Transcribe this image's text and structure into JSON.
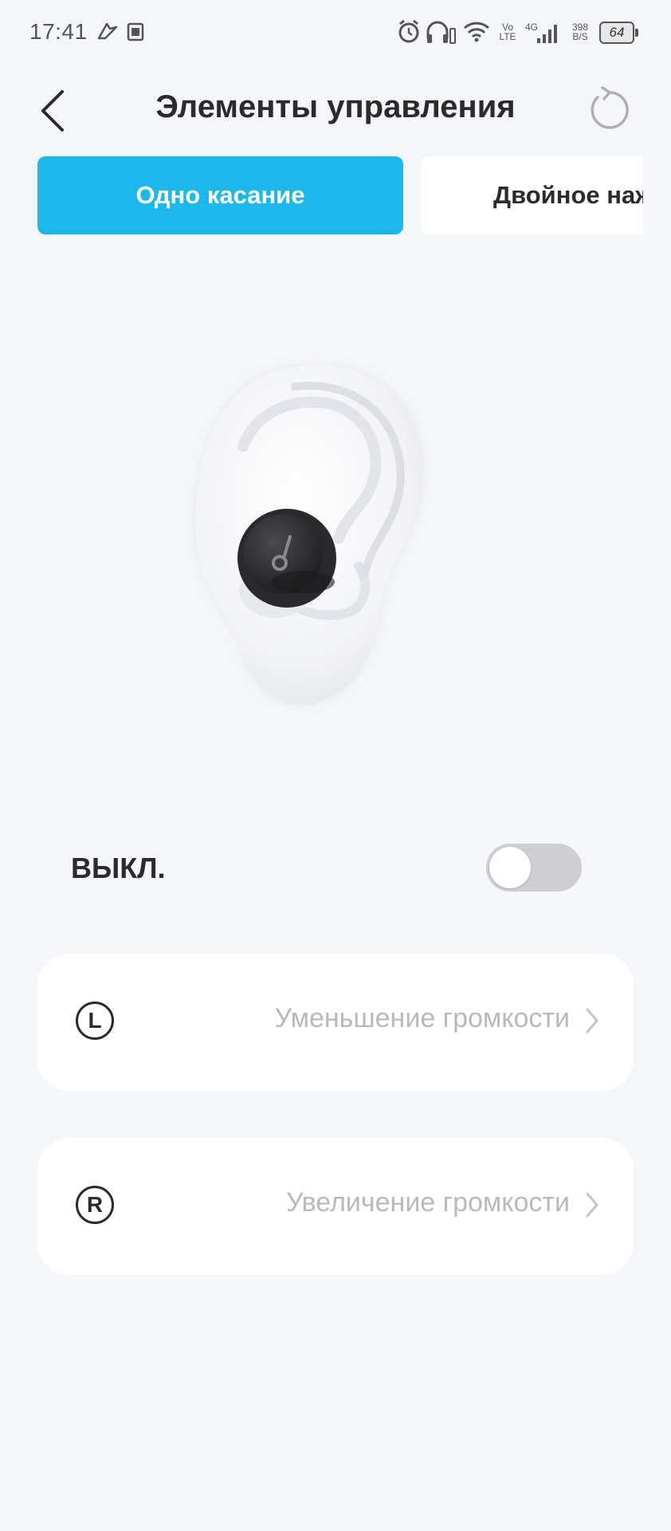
{
  "status_bar": {
    "time": "17:41",
    "volte_top": "Vo",
    "volte_bottom": "LTE",
    "network": "4G",
    "speed_top": "398",
    "speed_bottom": "B/S",
    "battery": "64",
    "icons": [
      "brand-icon",
      "calendar-icon",
      "alarm-icon",
      "headphones-icon",
      "wifi-icon",
      "signal-icon",
      "battery-icon"
    ]
  },
  "header": {
    "title": "Элементы управления",
    "back_icon": "chevron-left-icon",
    "reset_icon": "reset-icon"
  },
  "tabs": [
    {
      "label": "Одно касание",
      "active": true
    },
    {
      "label": "Двойное нажатие",
      "active": false
    }
  ],
  "toggle": {
    "label": "ВЫКЛ.",
    "on": false
  },
  "options": [
    {
      "side": "L",
      "value": "Уменьшение громкости"
    },
    {
      "side": "R",
      "value": "Увеличение громкости"
    }
  ],
  "colors": {
    "accent": "#1bb8ec",
    "background": "#f5f6fa",
    "card": "#ffffff",
    "text": "#2b2b2b",
    "muted_text": "#b9b9bd",
    "toggle_off": "#cfcfd3"
  }
}
